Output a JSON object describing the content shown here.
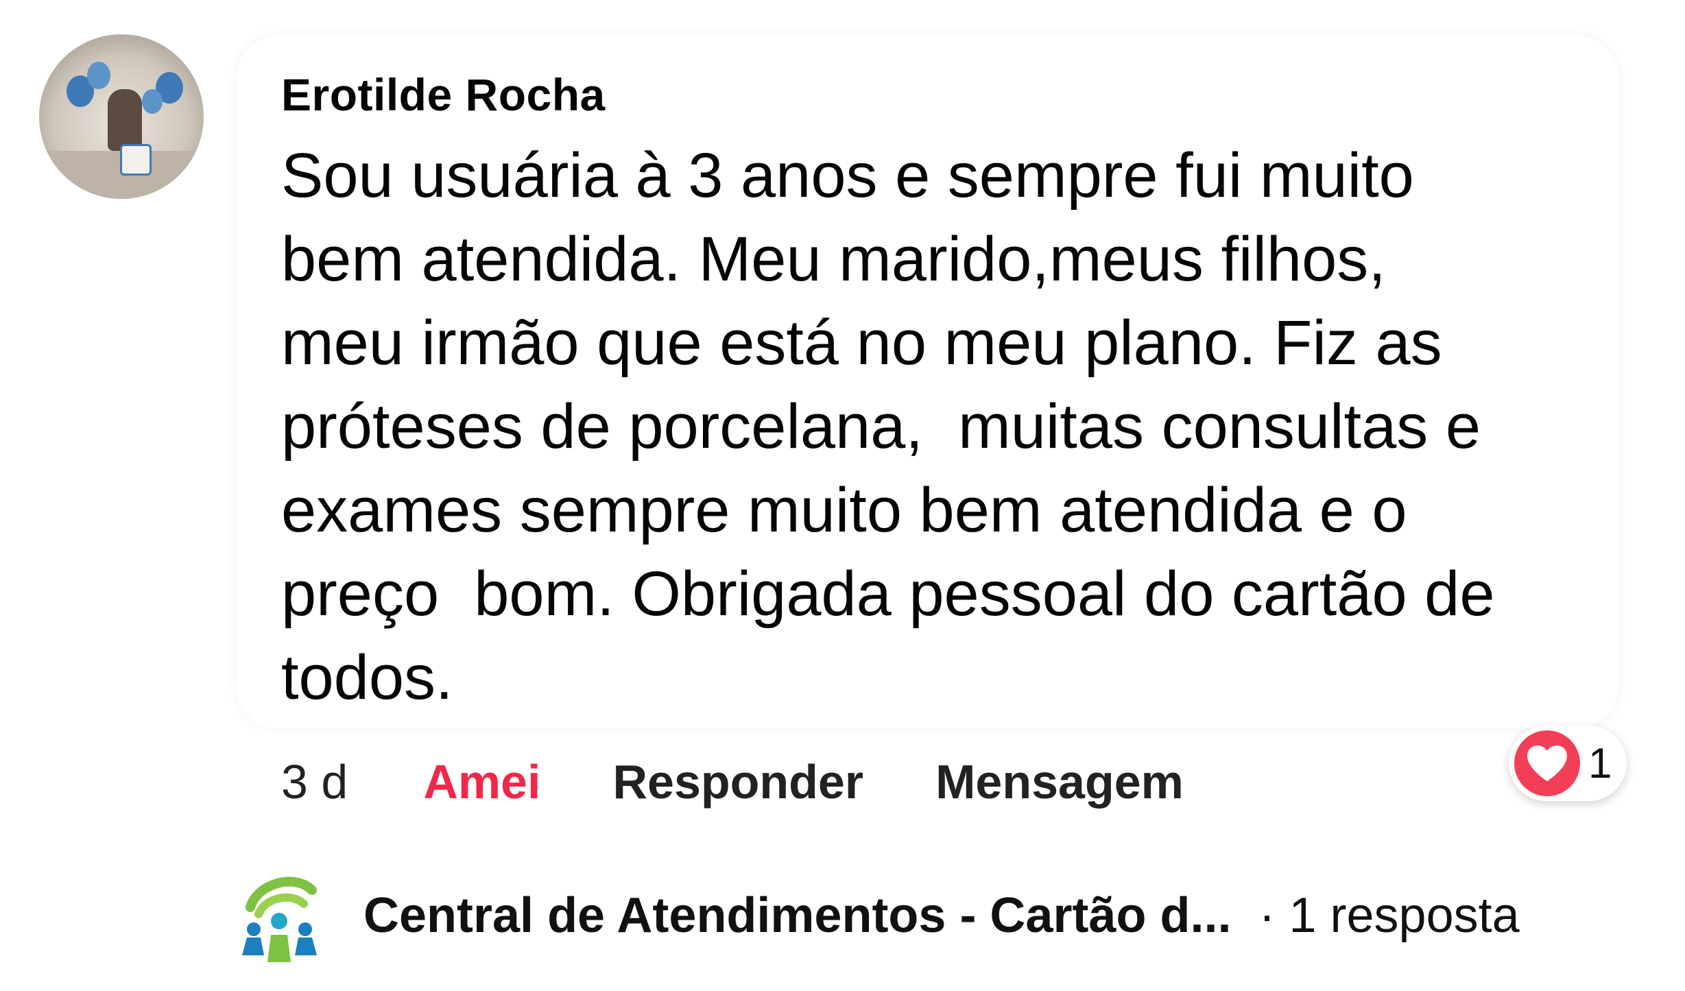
{
  "comment": {
    "author": "Erotilde Rocha",
    "text": "Sou usuária à 3 anos e sempre fui muito\nbem atendida. Meu marido,meus filhos,\nmeu irmão que está no meu plano. Fiz as\npróteses de porcelana,  muitas consultas e\nexames sempre muito bem atendida e o\npreço  bom. Obrigada pessoal do cartão de\ntodos.",
    "avatar_icon": "profile-photo"
  },
  "actions": {
    "time": "3 d",
    "reaction_label": "Amei",
    "reply_label": "Responder",
    "message_label": "Mensagem"
  },
  "reactions": {
    "icon": "heart-icon",
    "count": "1",
    "color": "#f33e58"
  },
  "reply_thread": {
    "name": "Central de Atendimentos - Cartão d...",
    "count_text": "· 1 resposta",
    "logo_icon": "cartao-de-todos-logo"
  },
  "colors": {
    "accent_red": "#f02849",
    "text": "#050505"
  }
}
